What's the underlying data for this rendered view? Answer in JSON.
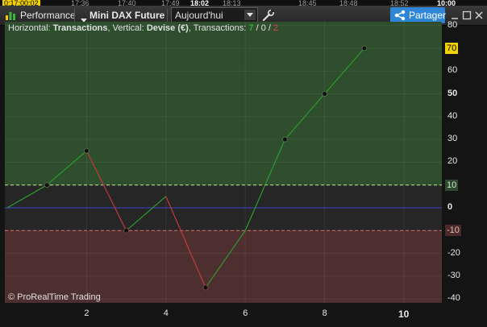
{
  "background_times": [
    "0:17:00:02",
    "17:36",
    "17:40",
    "17:49",
    "18:02",
    "18:13",
    "18:45",
    "18:48",
    "18:52",
    "10:00"
  ],
  "titlebar": {
    "performance_label": "Performance",
    "instrument_label": "Mini DAX Future",
    "period_select": {
      "value": "Aujourd'hui"
    },
    "share_label": "Partager"
  },
  "legend": {
    "horizontal_label": "Horizontal:",
    "horizontal_value": "Transactions",
    "vertical_label": ", Vertical:",
    "vertical_value": "Devise (€)",
    "transactions_label": ", Transactions:",
    "wins": "7",
    "sep1": " / ",
    "neutral": "0",
    "sep2": " / ",
    "losses": "2"
  },
  "copyright": "© ProRealTime Trading",
  "chart_data": {
    "type": "line",
    "x_label": "Transactions",
    "y_label": "Devise (€)",
    "x": [
      0,
      1,
      2,
      3,
      4,
      5,
      6,
      7,
      8,
      9
    ],
    "y": [
      0,
      10,
      25,
      -10,
      5,
      -35,
      -10,
      30,
      50,
      70
    ],
    "xlim": [
      0,
      11
    ],
    "ylim": [
      -45,
      80
    ],
    "x_ticks": [
      2,
      4,
      6,
      8,
      10
    ],
    "y_ticks": [
      80,
      60,
      50,
      40,
      30,
      20,
      0,
      -20,
      -30,
      -40
    ],
    "y_labels_boxed": [
      {
        "value": 70,
        "text": "70",
        "bg": "#f2d200",
        "fg": "#000000"
      },
      {
        "value": 10,
        "text": "10",
        "bg": "#2f4a2f",
        "fg": "#c8e6c8"
      },
      {
        "value": -10,
        "text": "-10",
        "bg": "#4a2a2a",
        "fg": "#e6b8b8"
      }
    ],
    "bold_y_ticks": [
      50,
      0
    ],
    "bold_x_ticks": [
      10
    ],
    "upper_threshold": 10,
    "lower_threshold": -10,
    "zero_line": 0,
    "colors": {
      "gain_zone": "#2e4e2e",
      "loss_zone": "#4e2f2f",
      "neutral_zone": "#262626",
      "up_segment": "#2d9a2d",
      "down_segment": "#c23b3b",
      "zero_line": "#3a44c8",
      "upper_dashed": "#c8e89a",
      "lower_dashed": "#e07070",
      "win_count": "#39d339",
      "loss_count": "#e04545"
    }
  }
}
